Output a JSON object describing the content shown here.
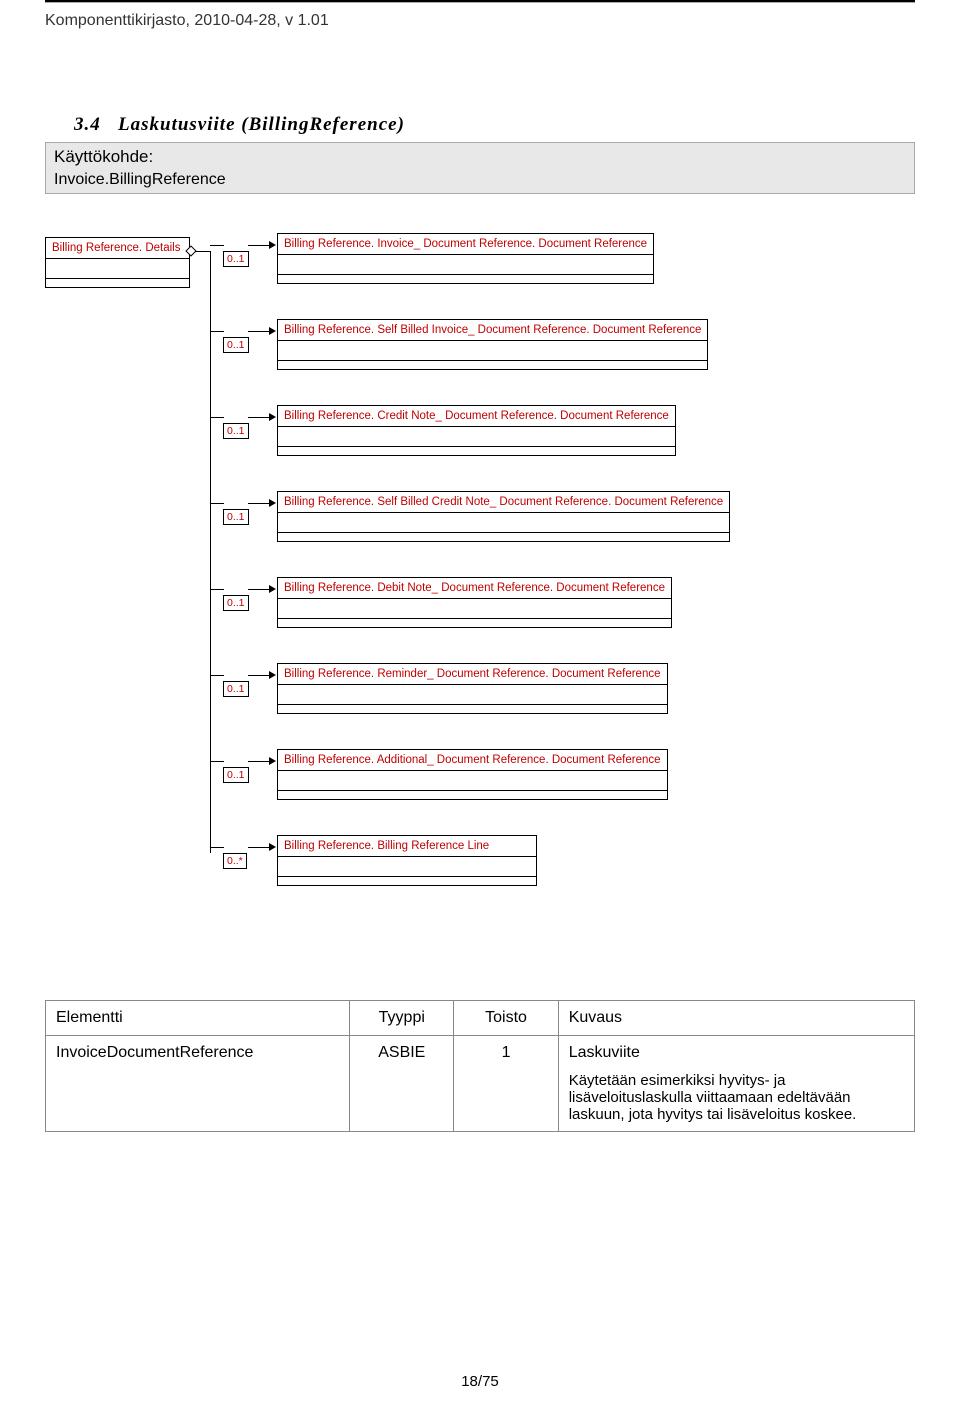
{
  "header": "Komponenttikirjasto, 2010-04-28, v 1.01",
  "section": {
    "number": "3.4",
    "title_bold": "Laskutusviite (BillingReference)"
  },
  "kayttokohde": {
    "label": "Käyttökohde:",
    "value": "Invoice.BillingReference"
  },
  "diagram": {
    "root": "Billing Reference. Details",
    "items": [
      {
        "card": "0..1",
        "label": "Billing Reference. Invoice_ Document Reference. Document Reference"
      },
      {
        "card": "0..1",
        "label": "Billing Reference. Self Billed Invoice_ Document Reference. Document Reference"
      },
      {
        "card": "0..1",
        "label": "Billing Reference. Credit Note_ Document Reference. Document Reference"
      },
      {
        "card": "0..1",
        "label": "Billing Reference. Self Billed Credit Note_ Document Reference. Document Reference"
      },
      {
        "card": "0..1",
        "label": "Billing Reference. Debit Note_ Document Reference. Document Reference"
      },
      {
        "card": "0..1",
        "label": "Billing Reference. Reminder_ Document Reference. Document Reference"
      },
      {
        "card": "0..1",
        "label": "Billing Reference. Additional_ Document Reference. Document Reference"
      },
      {
        "card": "0..*",
        "label": "Billing Reference. Billing Reference Line"
      }
    ]
  },
  "table": {
    "headers": {
      "c1": "Elementti",
      "c2": "Tyyppi",
      "c3": "Toisto",
      "c4": "Kuvaus"
    },
    "row": {
      "c1": "InvoiceDocumentReference",
      "c2": "ASBIE",
      "c3": "1",
      "c4a": "Laskuviite",
      "c4b": "Käytetään esimerkiksi hyvitys- ja lisäveloituslaskulla viittaamaan edeltävään laskuun, jota hyvitys tai lisäveloitus koskee."
    }
  },
  "footer": "18/75"
}
